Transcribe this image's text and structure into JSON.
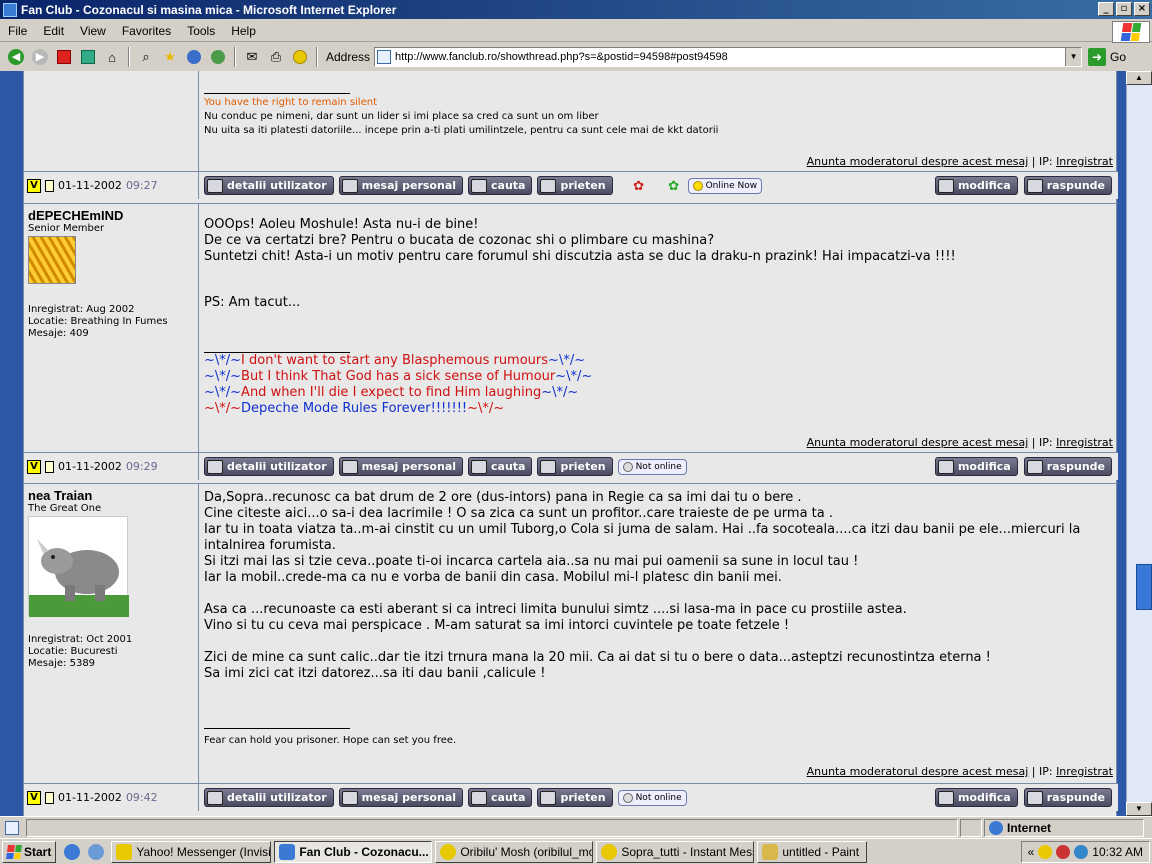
{
  "window": {
    "title": "Fan Club - Cozonacul si masina mica - Microsoft Internet Explorer",
    "controls": [
      "_",
      "▫",
      "×"
    ]
  },
  "menu": [
    "File",
    "Edit",
    "View",
    "Favorites",
    "Tools",
    "Help"
  ],
  "toolbar": {
    "address_label": "Address",
    "url": "http://www.fanclub.ro/showthread.php?s=&postid=94598#post94598",
    "go_label": "Go"
  },
  "report_link": "Anunta moderatorul despre acest mesaj",
  "ip_label": "| IP:",
  "ip_value": "Inregistrat",
  "buttons": {
    "details": "detalii utilizator",
    "pm": "mesaj personal",
    "search": "cauta",
    "friend": "prieten",
    "edit": "modifica",
    "reply": "raspunde"
  },
  "post0": {
    "sig_title": "You have the right to remain silent",
    "sig_lines": [
      "Nu conduc pe nimeni, dar sunt un lider si imi place sa cred ca sunt un om liber",
      "Nu uita sa iti platesti datoriile... incepe prin a-ti plati umilintzele, pentru ca sunt cele mai de kkt datorii"
    ],
    "date": "01-11-2002",
    "time": "09:27",
    "status": "Online Now"
  },
  "post1": {
    "username": "dEPECHEmIND",
    "usertitle": "Senior Member",
    "registered": "Inregistrat: Aug 2002",
    "location": "Locatie: Breathing In Fumes",
    "posts": "Mesaje: 409",
    "lines": [
      "OOOps!  Aoleu Moshule!  Asta nu-i de bine!",
      "De ce va certatzi bre? Pentru o bucata de cozonac shi o plimbare cu mashina?",
      "Suntetzi chit! Asta-i un motiv pentru care forumul shi discutzia asta se duc la draku-n prazink! Hai impacatzi-va !!!!",
      "",
      "PS:  Am tacut..."
    ],
    "sig": [
      {
        "pre": "~\\*/~",
        "text": "I don't want to start any Blasphemous rumours",
        "post": "~\\*/~"
      },
      {
        "pre": "~\\*/~",
        "text": "But I think That God has a sick sense of Humour",
        "post": "~\\*/~"
      },
      {
        "pre": "~\\*/~",
        "text": "And when I'll die I expect to find Him laughing",
        "post": "~\\*/~"
      },
      {
        "pre": "~\\*/~",
        "text": "Depeche Mode Rules Forever!!!!!!!",
        "post": "~\\*/~"
      }
    ],
    "date": "01-11-2002",
    "time": "09:29",
    "status": "Not online"
  },
  "post2": {
    "username": "nea Traian",
    "usertitle": "The Great One",
    "registered": "Inregistrat: Oct 2001",
    "location": "Locatie: Bucuresti",
    "posts": "Mesaje: 5389",
    "lines": [
      "Da,Sopra..recunosc ca bat drum de 2 ore (dus-intors) pana in Regie ca sa imi dai tu o bere .",
      "Cine citeste aici...o sa-i dea lacrimile ! O sa zica ca sunt un profitor..care traieste de pe urma ta .",
      "Iar tu in toata viatza ta..m-ai cinstit cu un umil Tuborg,o Cola si juma de salam. Hai ..fa socoteala....ca itzi dau banii pe ele...miercuri la",
      "intalnirea forumista.",
      "Si itzi mai las si tzie ceva..poate ti-oi incarca cartela aia..sa nu mai pui oamenii sa sune in locul tau !",
      "Iar la mobil..crede-ma ca nu e vorba de banii din casa. Mobilul mi-l platesc din banii mei.",
      "",
      "Asa ca ...recunoaste ca esti aberant si ca intreci limita bunului simtz ....si lasa-ma in pace cu prostiile astea.",
      "Vino si tu cu ceva mai perspicace . M-am saturat sa imi intorci cuvintele pe toate fetzele !",
      "",
      "Zici de mine ca sunt calic..dar tie itzi trnura mana la 20 mii. Ca ai dat si tu o bere o data...asteptzi recunostintza eterna !",
      "Sa imi zici cat itzi datorez...sa iti dau banii ,calicule !"
    ],
    "sig": "Fear can hold you prisoner. Hope can set you free.",
    "date": "01-11-2002",
    "time": "09:42",
    "status": "Not online"
  },
  "statusbar": {
    "zone": "Internet"
  },
  "taskbar": {
    "start": "Start",
    "tasks": [
      "Yahoo! Messenger (Invisi...",
      "Fan Club - Cozonacu...",
      "Oribilu' Mosh (oribilul_mos...",
      "Sopra_tutti - Instant Mess...",
      "untitled - Paint"
    ],
    "clock": "10:32 AM",
    "tray_chevron": "«"
  },
  "colors": {
    "accent": "#0a246a",
    "forum_bg": "#e8e8e8",
    "page_bg": "#2d58a8",
    "sig_orange": "#e05a00",
    "sig_blue": "#1030d0",
    "sig_red": "#d01010"
  }
}
